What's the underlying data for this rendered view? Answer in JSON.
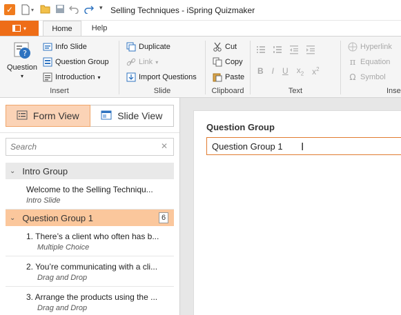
{
  "window": {
    "title": "Selling Techniques - iSpring Quizmaker"
  },
  "ribbon_tabs": {
    "home": "Home",
    "help": "Help"
  },
  "ribbon": {
    "insert": {
      "label": "Insert",
      "question": "Question",
      "info_slide": "Info Slide",
      "question_group": "Question Group",
      "introduction": "Introduction"
    },
    "slide": {
      "label": "Slide",
      "duplicate": "Duplicate",
      "link": "Link",
      "import_questions": "Import Questions"
    },
    "clipboard": {
      "label": "Clipboard",
      "cut": "Cut",
      "copy": "Copy",
      "paste": "Paste"
    },
    "text": {
      "label": "Text"
    },
    "insert2": {
      "label": "Inse",
      "hyperlink": "Hyperlink",
      "equation": "Equation",
      "symbol": "Symbol"
    }
  },
  "colors": {
    "accent": "#ee6d17",
    "selected": "#fbc79c"
  },
  "view_toggle": {
    "form_view": "Form View",
    "slide_view": "Slide View"
  },
  "search": {
    "placeholder": "Search"
  },
  "tree": {
    "groups": [
      {
        "name": "Intro Group",
        "slides": [
          {
            "title": "Welcome to the Selling Techniqu...",
            "type": "Intro Slide"
          }
        ]
      },
      {
        "name": "Question Group 1",
        "count": "6",
        "slides": [
          {
            "title": "1. There’s a client who often has b...",
            "type": "Multiple Choice"
          },
          {
            "title": "2. You’re communicating with a cli...",
            "type": "Drag and Drop"
          },
          {
            "title": "3. Arrange the products using the ...",
            "type": "Drag and Drop"
          }
        ]
      }
    ]
  },
  "editor": {
    "label": "Question Group",
    "value": "Question Group 1"
  }
}
